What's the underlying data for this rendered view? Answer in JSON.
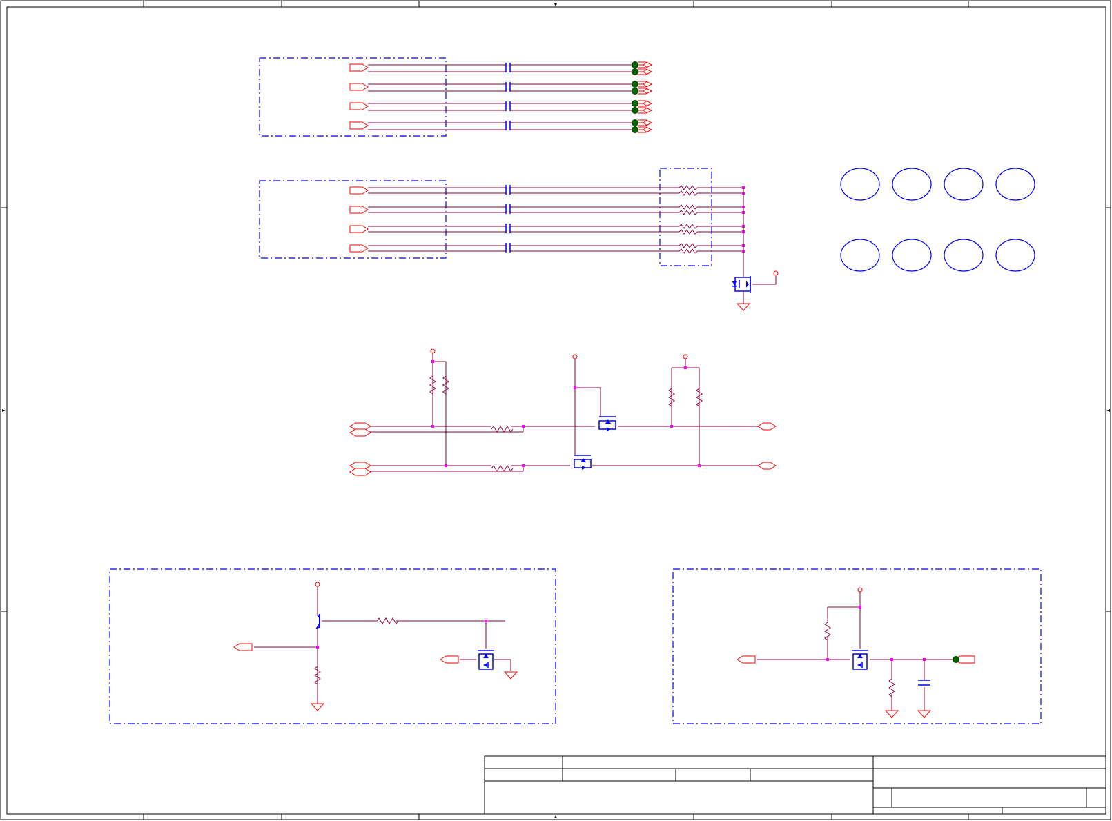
{
  "document": {
    "type": "schematic-sheet",
    "text_labels": [],
    "title_block": {
      "visible_text": []
    }
  },
  "colors": {
    "border": "#000000",
    "wire": "#8b0046",
    "port": "#ff0000",
    "component": "#0000ff",
    "group_box": "#0000ff",
    "junction": "#ff00ff",
    "test_point": "#006400"
  },
  "sections": {
    "top_bus_group": {
      "channels": 4,
      "nets_per_channel": 2,
      "endpoint": "test-point"
    },
    "second_bus_group": {
      "channels": 4,
      "nets_per_channel": 2,
      "endpoint": "termination-resistor-array"
    },
    "level_shifter": {
      "channels": 2,
      "transistors": 2
    },
    "lower_left_driver": {
      "transistors": 2
    },
    "lower_right_switch": {
      "transistors": 1
    },
    "mounting_holes": {
      "count": 8
    }
  },
  "icons": {
    "ground": "ground-icon",
    "power": "power-pin-icon",
    "mosfet": "mosfet-icon",
    "bjt": "bjt-icon",
    "resistor": "resistor-icon",
    "capacitor": "capacitor-icon",
    "test_point": "test-point-icon",
    "mounting_hole": "mounting-hole-icon"
  }
}
